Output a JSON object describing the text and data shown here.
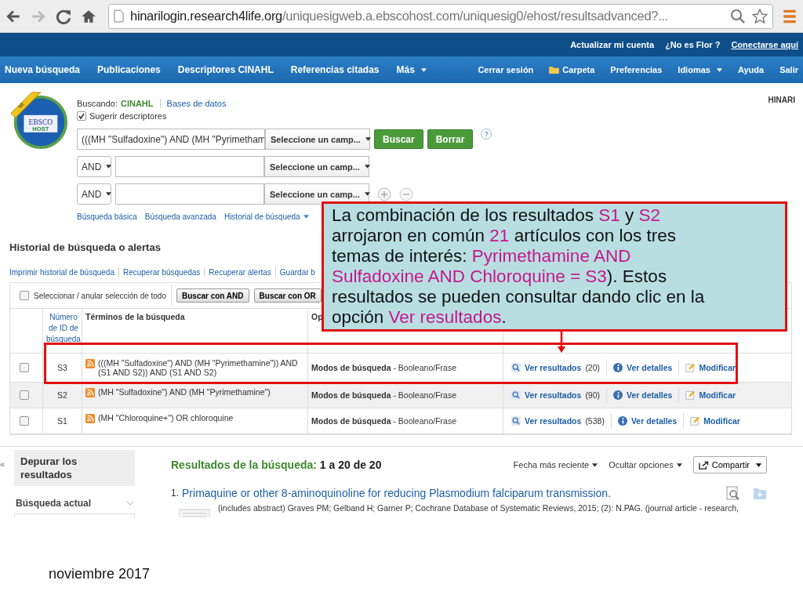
{
  "browser": {
    "url_host": "hinarilogin.research4life.org",
    "url_path": "/uniquesigweb.a.ebscohost.com/uniquesig0/ehost/resultsadvanced?..."
  },
  "top_bar": [
    {
      "text": "Actualizar mi cuenta",
      "kind": "link"
    },
    {
      "text": "¿No es Flor ?",
      "kind": "text"
    },
    {
      "text": "Conectarse aquí",
      "kind": "underlined"
    }
  ],
  "nav_left": [
    {
      "label": "Nueva búsqueda",
      "kind": "plain"
    },
    {
      "label": "Publicaciones",
      "kind": "plain"
    },
    {
      "label": "Descriptores CINAHL",
      "kind": "plain"
    },
    {
      "label": "Referencias citadas",
      "kind": "plain"
    },
    {
      "label": "Más",
      "kind": "dropdown"
    }
  ],
  "nav_right": [
    {
      "label": "Cerrar sesión",
      "kind": "plain"
    },
    {
      "label": "Carpeta",
      "kind": "folder"
    },
    {
      "label": "Preferencias",
      "kind": "plain"
    },
    {
      "label": "Idiomas",
      "kind": "dropdown"
    },
    {
      "label": "Ayuda",
      "kind": "plain"
    },
    {
      "label": "Salir",
      "kind": "plain"
    }
  ],
  "logo": {
    "ribbon": "MI",
    "name": "EBSCO",
    "sub": "HOST"
  },
  "brand": "HINARI",
  "search": {
    "searching_label": "Buscando:",
    "database": "CINAHL",
    "databases_link": "Bases de datos",
    "suggest": {
      "label": "Sugerir descriptores",
      "checked": true
    },
    "rows": [
      {
        "value": "(((MH \"Sulfadoxine\") AND (MH \"Pyrimetham",
        "field": "Seleccione un camp..."
      },
      {
        "operator": "AND",
        "field": "Seleccione un camp..."
      },
      {
        "operator": "AND",
        "field": "Seleccione un camp..."
      }
    ],
    "buttons": [
      "Buscar",
      "Borrar"
    ],
    "help": "?",
    "links": [
      {
        "label": "Búsqueda básica",
        "dropdown": false
      },
      {
        "label": "Búsqueda avanzada",
        "dropdown": false
      },
      {
        "label": "Historial de búsqueda",
        "dropdown": true
      }
    ]
  },
  "history": {
    "title": "Historial de búsqueda o alertas",
    "toolbar": [
      "Imprimir historial de búsqueda",
      "Recuperar búsquedas",
      "Recuperar alertas",
      "Guardar b"
    ],
    "select_all": {
      "label": "Seleccionar / anular selección de todo",
      "checked": false
    },
    "buttons": [
      "Buscar con AND",
      "Buscar con OR"
    ],
    "columns": [
      "Número de ID de búsqueda",
      "Términos de la búsqueda",
      "Op"
    ],
    "rows": [
      {
        "checked": false,
        "id": "S3",
        "terms": "(((MH \"Sulfadoxine\") AND (MH \"Pyrimethamine\")) AND (S1 AND S2)) AND (S1 AND S2)",
        "mode_label": "Modos de búsqueda",
        "mode_value": " - Booleano/Frase",
        "results": "Ver resultados",
        "count": "(20)",
        "details": "Ver detalles",
        "modify": "Modificar"
      },
      {
        "checked": false,
        "id": "S2",
        "terms": "(MH \"Sulfadoxine\") AND (MH \"Pyrimethamine\")",
        "mode_label": "Modos de búsqueda",
        "mode_value": " - Booleano/Frase",
        "results": "Ver resultados",
        "count": "(90)",
        "details": "Ver detalles",
        "modify": "Modificar"
      },
      {
        "checked": false,
        "id": "S1",
        "terms": "(MH \"Chloroquine+\") OR chloroquine",
        "mode_label": "Modos de búsqueda",
        "mode_value": " - Booleano/Frase",
        "results": "Ver resultados",
        "count": "(538)",
        "details": "Ver detalles",
        "modify": "Modificar"
      }
    ]
  },
  "results": {
    "collapse": "«",
    "refine": "Depurar los resultados",
    "current": "Búsqueda actual",
    "label": "Resultados de la búsqueda:",
    "range": "1 a 20 de 20",
    "sort": "Fecha más reciente",
    "hide": "Ocultar opciones",
    "share": "Compartir",
    "items": [
      {
        "number": "1.",
        "title": "Primaquine or other 8-aminoquinoline for reducing Plasmodium falciparum transmission.",
        "meta": "(includes abstract) Graves PM; Gelband H; Garner P; Cochrane Database of Systematic Reviews, 2015; (2): N.PAG. (journal article - research,"
      }
    ]
  },
  "callout": [
    {
      "text": "La combinación de los resultados ",
      "highlight": false
    },
    {
      "text": "S1",
      "highlight": true
    },
    {
      "text": " y ",
      "highlight": false
    },
    {
      "text": "S2",
      "highlight": true
    },
    {
      "text": " arrojaron en común ",
      "highlight": false
    },
    {
      "text": "21",
      "highlight": true
    },
    {
      "text": " artículos con los tres temas de interés: ",
      "highlight": false
    },
    {
      "text": "Pyrimethamine AND Sulfadoxine AND Chloroquine  = S3",
      "highlight": true
    },
    {
      "text": "). Estos resultados se pueden consultar dando clic en la opción ",
      "highlight": false
    },
    {
      "text": "Ver resultados",
      "highlight": true
    },
    {
      "text": ".",
      "highlight": false
    }
  ],
  "footer": "noviembre 2017"
}
